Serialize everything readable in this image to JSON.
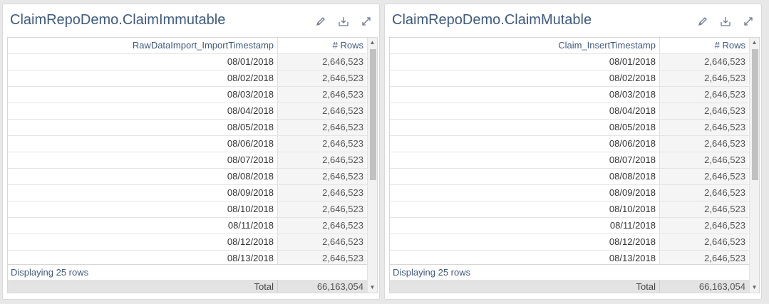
{
  "panels": [
    {
      "title": "ClaimRepoDemo.ClaimImmutable",
      "columns": [
        "RawDataImport_ImportTimestamp",
        "# Rows"
      ],
      "rows": [
        [
          "08/01/2018",
          "2,646,523"
        ],
        [
          "08/02/2018",
          "2,646,523"
        ],
        [
          "08/03/2018",
          "2,646,523"
        ],
        [
          "08/04/2018",
          "2,646,523"
        ],
        [
          "08/05/2018",
          "2,646,523"
        ],
        [
          "08/06/2018",
          "2,646,523"
        ],
        [
          "08/07/2018",
          "2,646,523"
        ],
        [
          "08/08/2018",
          "2,646,523"
        ],
        [
          "08/09/2018",
          "2,646,523"
        ],
        [
          "08/10/2018",
          "2,646,523"
        ],
        [
          "08/11/2018",
          "2,646,523"
        ],
        [
          "08/12/2018",
          "2,646,523"
        ],
        [
          "08/13/2018",
          "2,646,523"
        ]
      ],
      "footer": "Displaying 25 rows",
      "total_label": "Total",
      "total_value": "66,163,054"
    },
    {
      "title": "ClaimRepoDemo.ClaimMutable",
      "columns": [
        "Claim_InsertTimestamp",
        "# Rows"
      ],
      "rows": [
        [
          "08/01/2018",
          "2,646,523"
        ],
        [
          "08/02/2018",
          "2,646,523"
        ],
        [
          "08/03/2018",
          "2,646,523"
        ],
        [
          "08/04/2018",
          "2,646,523"
        ],
        [
          "08/05/2018",
          "2,646,523"
        ],
        [
          "08/06/2018",
          "2,646,523"
        ],
        [
          "08/07/2018",
          "2,646,523"
        ],
        [
          "08/08/2018",
          "2,646,523"
        ],
        [
          "08/09/2018",
          "2,646,523"
        ],
        [
          "08/10/2018",
          "2,646,523"
        ],
        [
          "08/11/2018",
          "2,646,523"
        ],
        [
          "08/12/2018",
          "2,646,523"
        ],
        [
          "08/13/2018",
          "2,646,523"
        ]
      ],
      "footer": "Displaying 25 rows",
      "total_label": "Total",
      "total_value": "66,163,054"
    }
  ],
  "icons": {
    "edit": "pencil-icon",
    "export": "download-icon",
    "expand": "expand-icon",
    "scroll_up": "caret-up-icon",
    "scroll_down": "caret-down-icon"
  },
  "colors": {
    "title": "#3f5a7e",
    "background": "#e8e8e8",
    "total_row": "#e3e3e3"
  }
}
